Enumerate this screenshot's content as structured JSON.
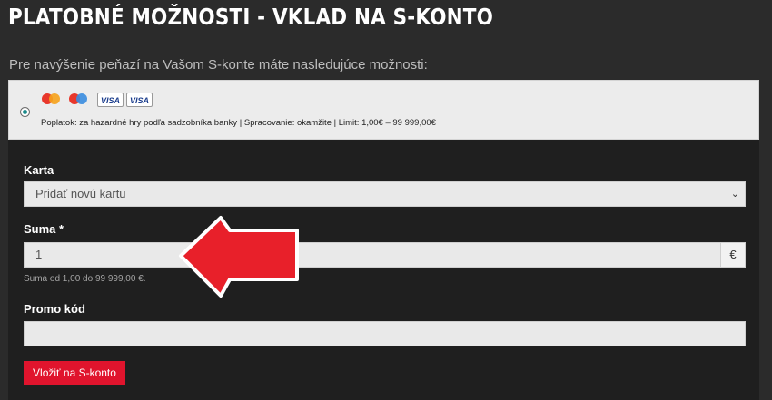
{
  "page": {
    "title": "PLATOBNÉ MOŽNOSTI - VKLAD NA S-KONTO",
    "subtitle": "Pre navýšenie peňazí na Vašom S-konte máte nasledujúce možnosti:"
  },
  "payment_option": {
    "selected": true,
    "logos": [
      "mastercard-icon",
      "maestro-icon",
      "visa-icon",
      "visa-icon"
    ],
    "visa_text": "VISA",
    "info": "Poplatok: za hazardné hry podľa sadzobníka banky | Spracovanie: okamžite | Limit: 1,00€ – 99 999,00€"
  },
  "form": {
    "card_label": "Karta",
    "card_selected": "Pridať novú kartu",
    "amount_label": "Suma *",
    "amount_value": "1",
    "currency": "€",
    "amount_hint": "Suma od 1,00 do 99 999,00 €.",
    "promo_label": "Promo kód",
    "promo_value": "",
    "submit_label": "Vložiť na S-konto"
  },
  "colors": {
    "background": "#2b2b2b",
    "panel": "#1f1f1f",
    "accent_red": "#e0142d",
    "radio_teal": "#1a8a8a"
  }
}
